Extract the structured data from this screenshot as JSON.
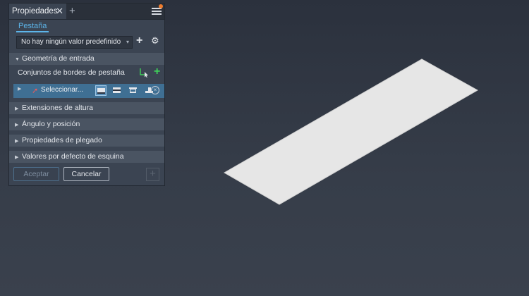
{
  "panel": {
    "tab_title": "Propiedades",
    "tab_close": "✕",
    "tab_add": "+",
    "subtab": "Pestaña",
    "preset": {
      "value": "No hay ningún valor predefinido",
      "caret": "▾",
      "add": "+",
      "gear": "⚙"
    },
    "sections": {
      "input_geometry": "Geometría de entrada",
      "height_extents": "Extensiones de altura",
      "angle_position": "Ángulo y posición",
      "bend_properties": "Propiedades de plegado",
      "corner_defaults": "Valores por defecto de esquina"
    },
    "edge_sets_label": "Conjuntos de bordes de pestaña",
    "edge_add": "+",
    "select_text": "Seleccionar...",
    "clear": "×",
    "buttons": {
      "accept": "Aceptar",
      "cancel": "Cancelar",
      "plus": "+"
    }
  },
  "colors": {
    "accent_blue": "#5cb5ea",
    "notify_orange": "#f07d2e",
    "add_green": "#3fd25a",
    "selection_row": "#3f6f93",
    "sheet_fill": "#e6e6e6"
  }
}
